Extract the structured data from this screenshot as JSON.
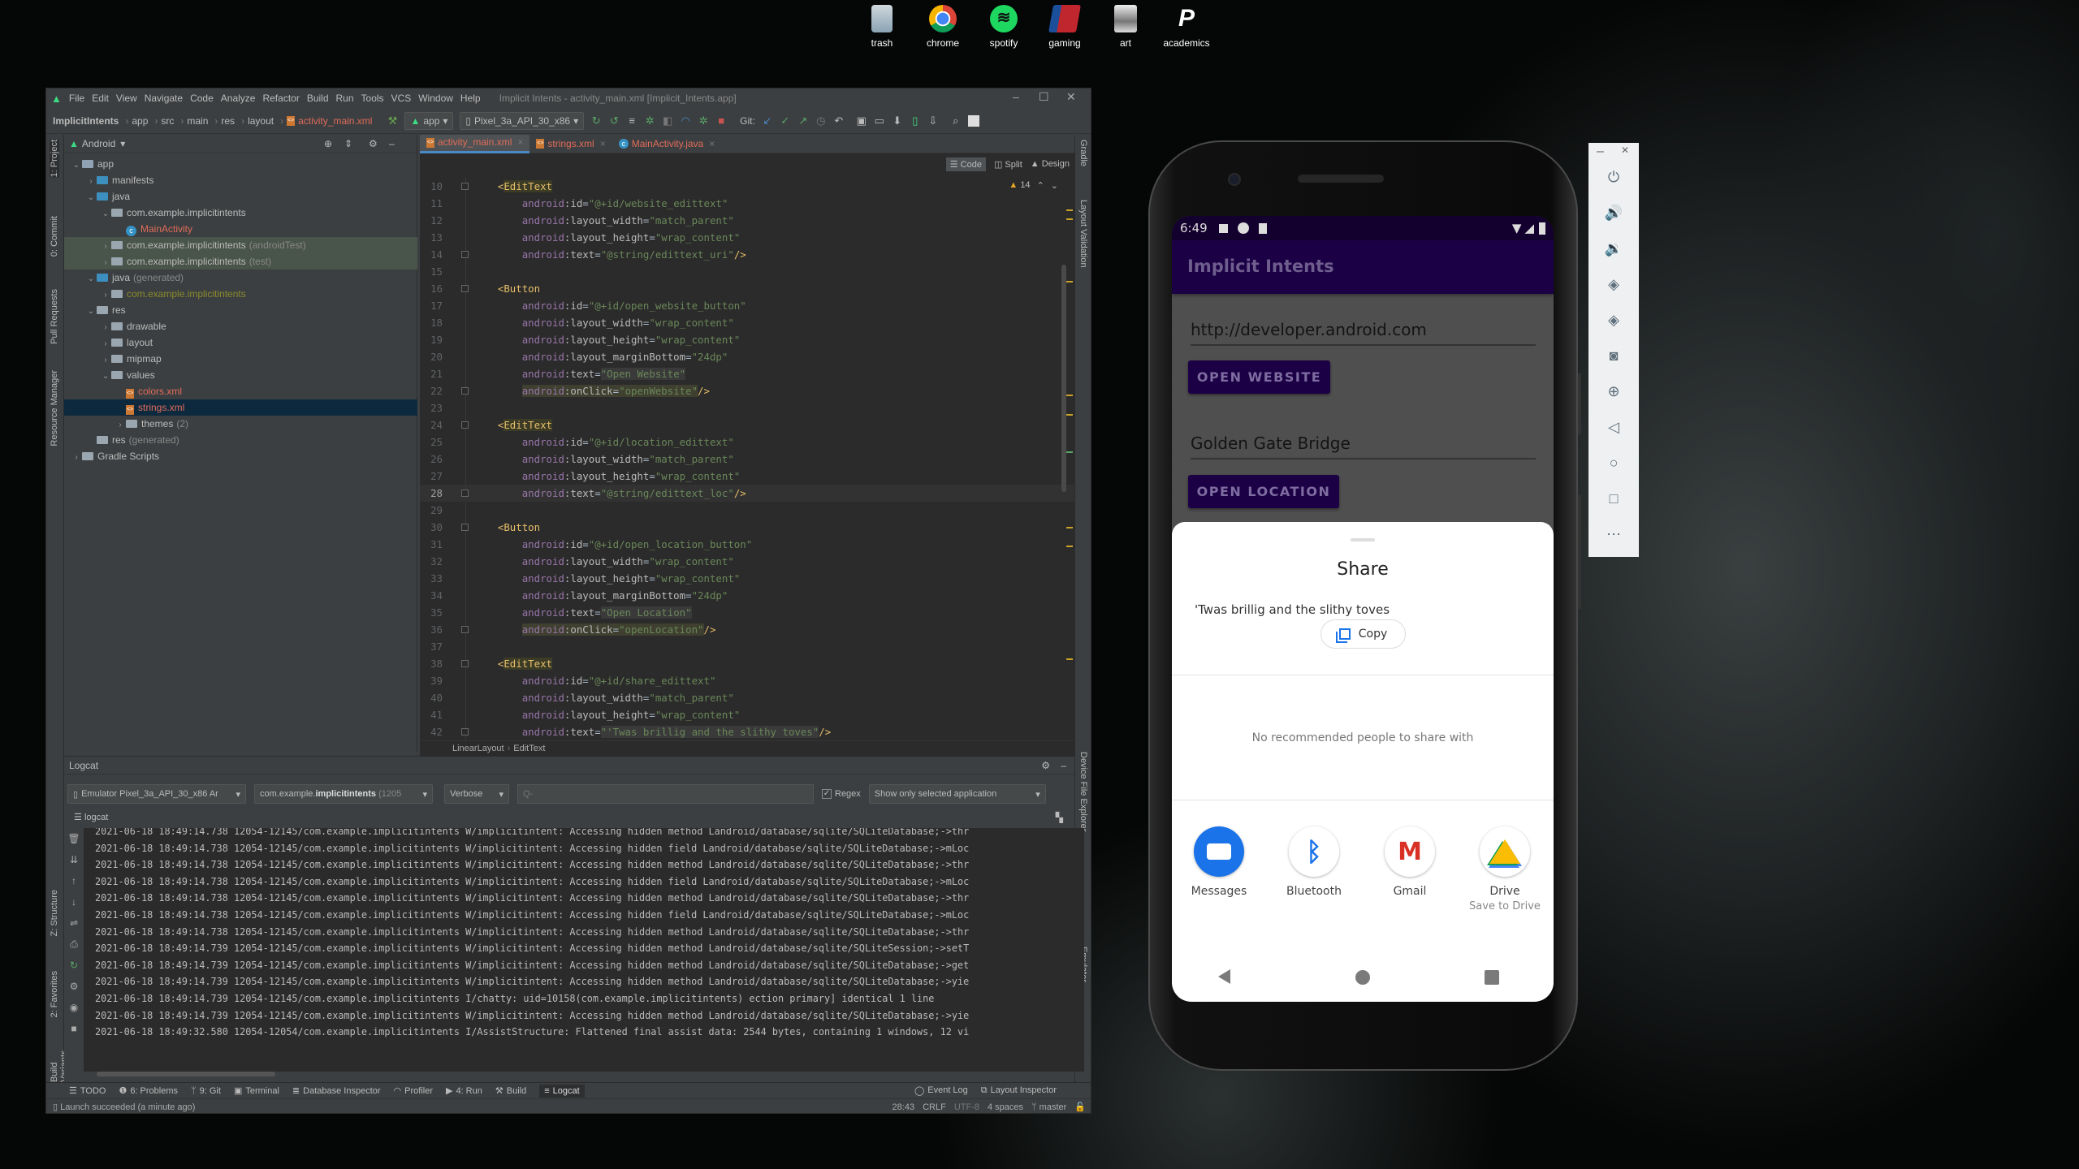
{
  "desktop": {
    "icons": [
      {
        "label": "trash",
        "icon": "recycle-bin-icon",
        "color": "#9fb8c8"
      },
      {
        "label": "chrome",
        "icon": "chrome-icon",
        "color": "#db4437"
      },
      {
        "label": "spotify",
        "icon": "spotify-icon",
        "color": "#1ed760"
      },
      {
        "label": "gaming",
        "icon": "gaming-icon",
        "color": "#c0262d"
      },
      {
        "label": "art",
        "icon": "art-icon",
        "color": "#dddddd"
      },
      {
        "label": "academics",
        "icon": "academics-icon",
        "color": "#ffffff"
      }
    ]
  },
  "ide": {
    "menu": [
      "File",
      "Edit",
      "View",
      "Navigate",
      "Code",
      "Analyze",
      "Refactor",
      "Build",
      "Run",
      "Tools",
      "VCS",
      "Window",
      "Help"
    ],
    "window_title": "Implicit Intents - activity_main.xml [Implicit_Intents.app]",
    "breadcrumb": [
      "ImplicitIntents",
      "app",
      "src",
      "main",
      "res",
      "layout",
      "activity_main.xml"
    ],
    "run_config": "app",
    "device": "Pixel_3a_API_30_x86",
    "git_label": "Git:",
    "project_view": "Android",
    "left_tools": [
      "1: Project",
      "0: Commit",
      "Pull Requests",
      "Resource Manager",
      "Z: Structure",
      "2: Favorites",
      "Build Variants"
    ],
    "right_tools": [
      "Gradle",
      "Layout Validation",
      "Device File Explorer",
      "Emulator"
    ],
    "tree": [
      {
        "label": "app",
        "level": 0,
        "arrow": "down",
        "icon": "module",
        "color": "normal"
      },
      {
        "label": "manifests",
        "level": 1,
        "arrow": "right",
        "icon": "folder-blue",
        "color": "normal"
      },
      {
        "label": "java",
        "level": 1,
        "arrow": "down",
        "icon": "folder-blue",
        "color": "normal"
      },
      {
        "label": "com.example.implicitintents",
        "level": 2,
        "arrow": "down",
        "icon": "package",
        "color": "normal"
      },
      {
        "label": "MainActivity",
        "level": 3,
        "arrow": "",
        "icon": "class",
        "color": "red"
      },
      {
        "label": "com.example.implicitintents",
        "suffix": "(androidTest)",
        "level": 2,
        "arrow": "right",
        "icon": "package",
        "color": "normal",
        "test": true
      },
      {
        "label": "com.example.implicitintents",
        "suffix": "(test)",
        "level": 2,
        "arrow": "right",
        "icon": "package",
        "color": "normal",
        "test": true
      },
      {
        "label": "java",
        "suffix": "(generated)",
        "level": 1,
        "arrow": "down",
        "icon": "folder-gen",
        "color": "normal"
      },
      {
        "label": "com.example.implicitintents",
        "level": 2,
        "arrow": "right",
        "icon": "package",
        "color": "olive"
      },
      {
        "label": "res",
        "level": 1,
        "arrow": "down",
        "icon": "folder-res",
        "color": "normal"
      },
      {
        "label": "drawable",
        "level": 2,
        "arrow": "right",
        "icon": "package",
        "color": "normal"
      },
      {
        "label": "layout",
        "level": 2,
        "arrow": "right",
        "icon": "package",
        "color": "normal"
      },
      {
        "label": "mipmap",
        "level": 2,
        "arrow": "right",
        "icon": "package",
        "color": "normal"
      },
      {
        "label": "values",
        "level": 2,
        "arrow": "down",
        "icon": "package",
        "color": "normal"
      },
      {
        "label": "colors.xml",
        "level": 3,
        "arrow": "",
        "icon": "xml",
        "color": "red"
      },
      {
        "label": "strings.xml",
        "level": 3,
        "arrow": "",
        "icon": "xml",
        "color": "red",
        "selected": true
      },
      {
        "label": "themes",
        "suffix": "(2)",
        "level": 3,
        "arrow": "right",
        "icon": "package",
        "color": "normal"
      },
      {
        "label": "res",
        "suffix": "(generated)",
        "level": 1,
        "arrow": "",
        "icon": "folder-res",
        "color": "normal"
      },
      {
        "label": "Gradle Scripts",
        "level": 0,
        "arrow": "right",
        "icon": "gradle",
        "color": "normal"
      }
    ],
    "editor_tabs": [
      {
        "label": "activity_main.xml",
        "icon": "xml",
        "active": true
      },
      {
        "label": "strings.xml",
        "icon": "xml",
        "active": false
      },
      {
        "label": "MainActivity.java",
        "icon": "class",
        "active": false
      }
    ],
    "view_modes": {
      "code": "Code",
      "split": "Split",
      "design": "Design"
    },
    "warnings": "14",
    "code_lines": [
      {
        "n": "10",
        "text": "    <EditText",
        "hl": "tag"
      },
      {
        "n": "11",
        "text": "        android:id=\"@+id/website_edittext\""
      },
      {
        "n": "12",
        "text": "        android:layout_width=\"match_parent\""
      },
      {
        "n": "13",
        "text": "        android:layout_height=\"wrap_content\""
      },
      {
        "n": "14",
        "text": "        android:text=\"@string/edittext_uri\"/>"
      },
      {
        "n": "15",
        "text": ""
      },
      {
        "n": "16",
        "text": "    <Button"
      },
      {
        "n": "17",
        "text": "        android:id=\"@+id/open_website_button\""
      },
      {
        "n": "18",
        "text": "        android:layout_width=\"wrap_content\""
      },
      {
        "n": "19",
        "text": "        android:layout_height=\"wrap_content\""
      },
      {
        "n": "20",
        "text": "        android:layout_marginBottom=\"24dp\""
      },
      {
        "n": "21",
        "text": "        android:text=\"Open Website\"",
        "hl": "value"
      },
      {
        "n": "22",
        "text": "        android:onClick=\"openWebsite\"/>",
        "hl": "whole"
      },
      {
        "n": "23",
        "text": ""
      },
      {
        "n": "24",
        "text": "    <EditText",
        "hl": "tag"
      },
      {
        "n": "25",
        "text": "        android:id=\"@+id/location_edittext\""
      },
      {
        "n": "26",
        "text": "        android:layout_width=\"match_parent\""
      },
      {
        "n": "27",
        "text": "        android:layout_height=\"wrap_content\""
      },
      {
        "n": "28",
        "text": "        android:text=\"@string/edittext_loc\"/>",
        "current": true
      },
      {
        "n": "29",
        "text": ""
      },
      {
        "n": "30",
        "text": "    <Button"
      },
      {
        "n": "31",
        "text": "        android:id=\"@+id/open_location_button\""
      },
      {
        "n": "32",
        "text": "        android:layout_width=\"wrap_content\""
      },
      {
        "n": "33",
        "text": "        android:layout_height=\"wrap_content\""
      },
      {
        "n": "34",
        "text": "        android:layout_marginBottom=\"24dp\""
      },
      {
        "n": "35",
        "text": "        android:text=\"Open Location\"",
        "hl": "value"
      },
      {
        "n": "36",
        "text": "        android:onClick=\"openLocation\"/>",
        "hl": "whole"
      },
      {
        "n": "37",
        "text": ""
      },
      {
        "n": "38",
        "text": "    <EditText",
        "hl": "tag"
      },
      {
        "n": "39",
        "text": "        android:id=\"@+id/share_edittext\""
      },
      {
        "n": "40",
        "text": "        android:layout_width=\"match_parent\""
      },
      {
        "n": "41",
        "text": "        android:layout_height=\"wrap_content\""
      },
      {
        "n": "42",
        "text": "        android:text=\"'Twas brillig and the slithy toves\"/>",
        "hl": "value"
      }
    ],
    "editor_breadcrumb": [
      "LinearLayout",
      "EditText"
    ],
    "logcat": {
      "title": "Logcat",
      "device": "Emulator Pixel_3a_API_30_x86 Ar",
      "process_prefix": "com.example.",
      "process_bold": "implicitintents",
      "process_suffix": " (1205",
      "level": "Verbose",
      "search_placeholder": "Q-",
      "regex_label": "Regex",
      "regex_checked": true,
      "filter": "Show only selected application",
      "subtab": "logcat",
      "lines": [
        "2021-06-18 18:49:14.738 12054-12145/com.example.implicitintents W/implicitintent: Accessing hidden method Landroid/database/sqlite/SQLiteDatabase;->thr",
        "2021-06-18 18:49:14.738 12054-12145/com.example.implicitintents W/implicitintent: Accessing hidden field Landroid/database/sqlite/SQLiteDatabase;->mLoc",
        "2021-06-18 18:49:14.738 12054-12145/com.example.implicitintents W/implicitintent: Accessing hidden method Landroid/database/sqlite/SQLiteDatabase;->thr",
        "2021-06-18 18:49:14.738 12054-12145/com.example.implicitintents W/implicitintent: Accessing hidden field Landroid/database/sqlite/SQLiteDatabase;->mLoc",
        "2021-06-18 18:49:14.738 12054-12145/com.example.implicitintents W/implicitintent: Accessing hidden method Landroid/database/sqlite/SQLiteDatabase;->thr",
        "2021-06-18 18:49:14.738 12054-12145/com.example.implicitintents W/implicitintent: Accessing hidden field Landroid/database/sqlite/SQLiteDatabase;->mLoc",
        "2021-06-18 18:49:14.738 12054-12145/com.example.implicitintents W/implicitintent: Accessing hidden method Landroid/database/sqlite/SQLiteDatabase;->thr",
        "2021-06-18 18:49:14.739 12054-12145/com.example.implicitintents W/implicitintent: Accessing hidden method Landroid/database/sqlite/SQLiteSession;->setT",
        "2021-06-18 18:49:14.739 12054-12145/com.example.implicitintents W/implicitintent: Accessing hidden method Landroid/database/sqlite/SQLiteDatabase;->get",
        "2021-06-18 18:49:14.739 12054-12145/com.example.implicitintents W/implicitintent: Accessing hidden method Landroid/database/sqlite/SQLiteDatabase;->yie",
        "2021-06-18 18:49:14.739 12054-12145/com.example.implicitintents I/chatty: uid=10158(com.example.implicitintents) ection primary] identical 1 line",
        "2021-06-18 18:49:14.739 12054-12145/com.example.implicitintents W/implicitintent: Accessing hidden method Landroid/database/sqlite/SQLiteDatabase;->yie",
        "2021-06-18 18:49:32.580 12054-12054/com.example.implicitintents I/AssistStructure: Flattened final assist data: 2544 bytes, containing 1 windows, 12 vi"
      ]
    },
    "bottom_tabs": [
      "TODO",
      "6: Problems",
      "9: Git",
      "Terminal",
      "Database Inspector",
      "Profiler",
      "4: Run",
      "Build",
      "Logcat"
    ],
    "bottom_right_tabs": [
      "Event Log",
      "Layout Inspector"
    ],
    "status": {
      "message": "Launch succeeded (a minute ago)",
      "position": "28:43",
      "line_sep": "CRLF",
      "encoding": "UTF-8",
      "indent": "4 spaces",
      "branch": "master"
    }
  },
  "phone": {
    "time": "6:49",
    "app_title": "Implicit Intents",
    "website_value": "http://developer.android.com",
    "open_website": "OPEN WEBSITE",
    "location_value": "Golden Gate Bridge",
    "open_location": "OPEN LOCATION",
    "share": {
      "title": "Share",
      "text": "'Twas brillig and the slithy toves",
      "copy": "Copy",
      "no_people": "No recommended people to share with",
      "apps": [
        {
          "label": "Messages",
          "sub": "",
          "icon": "messages-icon"
        },
        {
          "label": "Bluetooth",
          "sub": "",
          "icon": "bluetooth-icon"
        },
        {
          "label": "Gmail",
          "sub": "",
          "icon": "gmail-icon"
        },
        {
          "label": "Drive",
          "sub": "Save to Drive",
          "icon": "drive-icon"
        }
      ]
    },
    "colors": {
      "primary": "#1c0045",
      "scrim": "#4f4f4f"
    }
  },
  "emulator_controls": [
    "power",
    "volume-up",
    "volume-down",
    "rotate-left",
    "rotate-right",
    "screenshot",
    "zoom",
    "back",
    "home",
    "overview",
    "more"
  ]
}
